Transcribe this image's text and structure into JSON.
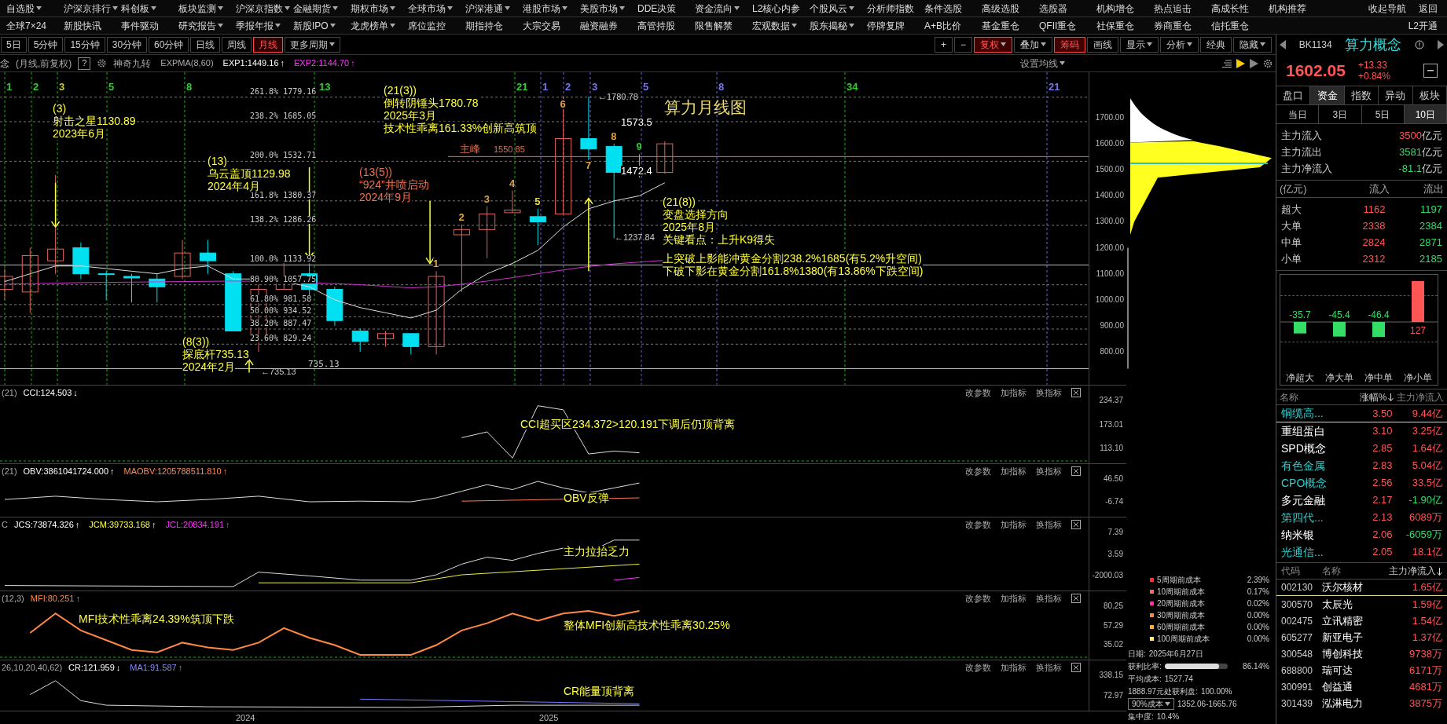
{
  "menu_rows": [
    {
      "items": [
        {
          "label": "自选股",
          "dropdown": true
        },
        {
          "label": "沪深京排行",
          "dropdown": true
        },
        {
          "label": "科创板",
          "dropdown": true
        },
        {
          "label": "板块监测",
          "dropdown": true
        },
        {
          "label": "沪深京指数",
          "dropdown": true
        },
        {
          "label": "金融期货",
          "dropdown": true
        },
        {
          "label": "期权市场",
          "dropdown": true
        },
        {
          "label": "全球市场",
          "dropdown": true
        },
        {
          "label": "沪深港通",
          "dropdown": true
        },
        {
          "label": "港股市场",
          "dropdown": true
        },
        {
          "label": "美股市场",
          "dropdown": true
        },
        {
          "label": "DDE决策",
          "dropdown": false
        },
        {
          "label": "资金流向",
          "dropdown": true
        },
        {
          "label": "L2核心内参",
          "dropdown": false
        },
        {
          "label": "个股风云",
          "dropdown": true
        },
        {
          "label": "分析师指数",
          "dropdown": false
        },
        {
          "label": "条件选股",
          "dropdown": false
        },
        {
          "label": "高级选股",
          "dropdown": false
        },
        {
          "label": "选股器",
          "dropdown": false
        },
        {
          "label": "机构增仓",
          "dropdown": false
        },
        {
          "label": "热点追击",
          "dropdown": false
        },
        {
          "label": "高成长性",
          "dropdown": false
        },
        {
          "label": "机构推荐",
          "dropdown": false
        }
      ],
      "right": [
        "收起导航",
        "返回"
      ]
    },
    {
      "items": [
        {
          "label": "全球7×24",
          "dropdown": false
        },
        {
          "label": "新股快讯",
          "dropdown": false
        },
        {
          "label": "事件驱动",
          "dropdown": false
        },
        {
          "label": "研究报告",
          "dropdown": true
        },
        {
          "label": "季报年报",
          "dropdown": true
        },
        {
          "label": "新股IPO",
          "dropdown": true
        },
        {
          "label": "龙虎榜单",
          "dropdown": true
        },
        {
          "label": "席位监控",
          "dropdown": false
        },
        {
          "label": "期指持仓",
          "dropdown": false
        },
        {
          "label": "大宗交易",
          "dropdown": false
        },
        {
          "label": "融资融券",
          "dropdown": false
        },
        {
          "label": "高管持股",
          "dropdown": false
        },
        {
          "label": "限售解禁",
          "dropdown": false
        },
        {
          "label": "宏观数据",
          "dropdown": true
        },
        {
          "label": "股东揭秘",
          "dropdown": true
        },
        {
          "label": "停牌复牌",
          "dropdown": false
        },
        {
          "label": "A+B比价",
          "dropdown": false
        },
        {
          "label": "基金重仓",
          "dropdown": false
        },
        {
          "label": "QFII重仓",
          "dropdown": false
        },
        {
          "label": "社保重仓",
          "dropdown": false
        },
        {
          "label": "券商重仓",
          "dropdown": false
        },
        {
          "label": "信托重仓",
          "dropdown": false
        }
      ],
      "right": [
        "L2开通"
      ]
    }
  ],
  "toolbar": {
    "periods": [
      {
        "label": "5日",
        "selected": false,
        "dropdown": false
      },
      {
        "label": "5分钟",
        "selected": false,
        "dropdown": false
      },
      {
        "label": "15分钟",
        "selected": false,
        "dropdown": false
      },
      {
        "label": "30分钟",
        "selected": false,
        "dropdown": false
      },
      {
        "label": "60分钟",
        "selected": false,
        "dropdown": false
      },
      {
        "label": "日线",
        "selected": false,
        "dropdown": false
      },
      {
        "label": "周线",
        "selected": false,
        "dropdown": false
      },
      {
        "label": "月线",
        "selected": true,
        "dropdown": false
      },
      {
        "label": "更多周期",
        "selected": false,
        "dropdown": true
      }
    ],
    "tools": [
      {
        "label": "+",
        "active": false,
        "dropdown": false
      },
      {
        "label": "−",
        "active": false,
        "dropdown": false
      },
      {
        "label": "复权",
        "active": true,
        "dropdown": true
      },
      {
        "label": "叠加",
        "active": false,
        "dropdown": true
      },
      {
        "label": "筹码",
        "active": true,
        "dropdown": false
      },
      {
        "label": "画线",
        "active": false,
        "dropdown": false
      },
      {
        "label": "显示",
        "active": false,
        "dropdown": true
      },
      {
        "label": "分析",
        "active": false,
        "dropdown": true
      },
      {
        "label": "经典",
        "active": false,
        "dropdown": false
      },
      {
        "label": "隐藏",
        "active": false,
        "dropdown": true
      }
    ]
  },
  "chart_header": {
    "name_fragment": "念",
    "mode": "(月线,前复权)",
    "help": "?",
    "indicator": "神奇九转",
    "expma": "EXPMA(8,60)",
    "values": [
      {
        "text": "EXP1:1449.16",
        "arrow": "↑",
        "color": "#ffffff"
      },
      {
        "text": "EXP2:1144.70",
        "arrow": "↑",
        "color": "#ff33ff"
      }
    ],
    "ma_setting": "设置均线"
  },
  "main_chart": {
    "count_marks": [
      {
        "text": "1",
        "color": "#33cc33"
      },
      {
        "text": "2",
        "color": "#33cc33"
      },
      {
        "text": "3",
        "color": "#cccc33"
      },
      {
        "text": "5",
        "color": "#33cc33"
      },
      {
        "text": "8",
        "color": "#33cc33"
      },
      {
        "text": "13",
        "color": "#33cc33"
      },
      {
        "text": "21",
        "color": "#33cc33"
      },
      {
        "text": "1",
        "color": "#7777ee"
      },
      {
        "text": "2",
        "color": "#7777ee"
      },
      {
        "text": "3",
        "color": "#7777ee"
      },
      {
        "text": "5",
        "color": "#7777ee"
      },
      {
        "text": "8",
        "color": "#7777ee"
      },
      {
        "text": "34",
        "color": "#33cc33"
      },
      {
        "text": "21",
        "color": "#7777ee"
      }
    ],
    "fib_levels": [
      "261.8% 1779.16",
      "238.2% 1685.05",
      "200.0% 1532.71",
      "161.8% 1380.37",
      "138.2% 1286.26",
      "100.0% 1133.92",
      "80.90% 1057.75",
      "61.80% 981.58",
      "50.00% 934.52",
      "38.20% 887.47",
      "23.60% 829.24"
    ],
    "base_label": "735.13",
    "candle_counts": [
      {
        "text": "1",
        "color": "#e0a040"
      },
      {
        "text": "2",
        "color": "#e0a040"
      },
      {
        "text": "3",
        "color": "#e0a040"
      },
      {
        "text": "4",
        "color": "#e0a040"
      },
      {
        "text": "5",
        "color": "#e0e040"
      },
      {
        "text": "6",
        "color": "#e0a040"
      },
      {
        "text": "7",
        "color": "#e0a040"
      },
      {
        "text": "8",
        "color": "#e0a040"
      },
      {
        "text": "9",
        "color": "#33cc33"
      }
    ],
    "annotations": [
      {
        "lines": [
          "(21(3))",
          "倒转阴锤头1780.78",
          "2025年3月",
          "技术性乖离161.33%创新高筑顶"
        ],
        "color": "#ffff40"
      },
      {
        "lines": [
          "(3)",
          "射击之星1130.89",
          "2023年6月"
        ],
        "color": "#ffff40"
      },
      {
        "lines": [
          "(13)",
          "乌云盖顶1129.98",
          "2024年4月"
        ],
        "color": "#ffff40"
      },
      {
        "lines": [
          "(13(5))",
          "“924”井喷启动",
          "2024年9月"
        ],
        "color": "#f07050"
      },
      {
        "lines": [
          "(21(8))",
          "变盘选择方向",
          "2025年8月",
          "关键看点：上升K9得失"
        ],
        "color": "#ffff40"
      },
      {
        "lines": [
          "上突破上影能冲黄金分割238.2%1685(有5.2%升空间)",
          "下破下影在黄金分割161.8%1380(有13.86%下跌空间)"
        ],
        "color": "#ffff40"
      },
      {
        "lines": [
          "(8(3))",
          "探底杆735.13",
          "2024年2月"
        ],
        "color": "#ffff40"
      }
    ],
    "title": "算力月线图",
    "peak": {
      "label": "主峰",
      "value": "1550.85"
    },
    "arrow_labels": [
      "←1780.78",
      "←1237.84",
      "←735.13"
    ],
    "price_notes": [
      "1573.5",
      "1472.4"
    ],
    "y_axis": [
      "1700.00",
      "1600.00",
      "1500.00",
      "1400.00",
      "1300.00",
      "1200.00",
      "1100.00",
      "1000.00",
      "900.00",
      "800.00"
    ]
  },
  "panels": [
    {
      "kind": "cci",
      "params": [
        "(21)"
      ],
      "values": [
        {
          "text": "CCI:124.503",
          "arrow": "↓",
          "color": "#ffffff"
        }
      ],
      "axis": [
        "234.37",
        "173.01",
        "113.10"
      ],
      "notes": [
        "CCI超买区234.372>120.191下调后仍顶背离"
      ]
    },
    {
      "kind": "obv",
      "params": [
        "(21)"
      ],
      "values": [
        {
          "text": "OBV:3861041724.000",
          "arrow": "↑",
          "color": "#ffffff"
        },
        {
          "text": "MAOBV:1205788511.810",
          "arrow": "↑",
          "color": "#ff8855"
        }
      ],
      "axis": [
        "46.50",
        "-6.74"
      ],
      "notes": [
        "OBV反弹"
      ]
    },
    {
      "kind": "jcs",
      "params": [
        "C"
      ],
      "values": [
        {
          "text": "JCS:73874.326",
          "arrow": "↑",
          "color": "#ffffff"
        },
        {
          "text": "JCM:39733.168",
          "arrow": "↑",
          "color": "#ffff40"
        },
        {
          "text": "JCL:20834.191",
          "arrow": "↑",
          "color": "#ff33ff"
        }
      ],
      "axis": [
        "7.39",
        "3.59",
        "-2000.03"
      ],
      "notes": [
        "主力拉抬乏力"
      ]
    },
    {
      "kind": "mfi",
      "params": [
        "(12,3)"
      ],
      "values": [
        {
          "text": "MFI:80.251",
          "arrow": "↑",
          "color": "#ff8844"
        }
      ],
      "axis": [
        "80.25",
        "57.29",
        "35.02"
      ],
      "notes": [
        "MFI技术性乖离24.39%筑顶下跌",
        "整体MFI创新高技术性乖离30.25%"
      ]
    },
    {
      "kind": "cr",
      "params": [
        "26,10,20,40,62)"
      ],
      "values": [
        {
          "text": "CR:121.959",
          "arrow": "↓",
          "color": "#ffffff"
        },
        {
          "text": "MA1:91.587",
          "arrow": "↑",
          "color": "#8888ff"
        }
      ],
      "axis": [
        "338.15",
        "72.97"
      ],
      "notes": [
        "CR能量顶背离"
      ]
    }
  ],
  "panel_actions": [
    [
      "改参数",
      "加指标",
      "换指标"
    ],
    [
      "改参数",
      "加指标",
      "换指标"
    ],
    [
      "改参数",
      "加指标",
      "换指标"
    ],
    [
      "改参数",
      "加指标",
      "换指标"
    ],
    [
      "改参数",
      "加指标",
      "换指标"
    ]
  ],
  "x_axis": [
    "2024",
    "2025"
  ],
  "cost_legend": {
    "items": [
      {
        "label": "5周期前成本",
        "value": "2.39%",
        "color": "#ff3333"
      },
      {
        "label": "10周期前成本",
        "value": "0.17%",
        "color": "#ff6666"
      },
      {
        "label": "20周期前成本",
        "value": "0.02%",
        "color": "#ff3399"
      },
      {
        "label": "30周期前成本",
        "value": "0.00%",
        "color": "#ff8833"
      },
      {
        "label": "60周期前成本",
        "value": "0.00%",
        "color": "#ffaa33"
      },
      {
        "label": "100周期前成本",
        "value": "0.00%",
        "color": "#ffee66"
      }
    ],
    "date": {
      "label": "日期:",
      "value": "2025年6月27日"
    },
    "profit": {
      "label": "获利比率:",
      "level": 0.8614,
      "value": "86.14%"
    },
    "avg_cost": {
      "label": "平均成本:",
      "value": "1527.74"
    },
    "profit_at": {
      "label": "1888.97元处获利盘:",
      "value": "100.00%"
    },
    "range": {
      "select": "90%成本",
      "value": "1352.06-1665.76"
    },
    "concentration": {
      "label": "集中度:",
      "value": "10.4%"
    }
  },
  "quote": {
    "code": "BK1134",
    "name": "算力概念",
    "price": "1602.05",
    "change": "+13.33",
    "change_pct": "+0.84%"
  },
  "tabs": [
    {
      "label": "盘口",
      "selected": false
    },
    {
      "label": "资金",
      "selected": true
    },
    {
      "label": "指数",
      "selected": false
    },
    {
      "label": "异动",
      "selected": false
    },
    {
      "label": "板块",
      "selected": false
    }
  ],
  "day_tabs": [
    {
      "label": "当日",
      "selected": false
    },
    {
      "label": "3日",
      "selected": false
    },
    {
      "label": "5日",
      "selected": false
    },
    {
      "label": "10日",
      "selected": true
    }
  ],
  "flow_summary": [
    {
      "label": "主力流入",
      "value": "3500",
      "unit": "亿元",
      "positive": true
    },
    {
      "label": "主力流出",
      "value": "3581",
      "unit": "亿元",
      "positive": false
    },
    {
      "label": "主力净流入",
      "value": "-81.1",
      "unit": "亿元",
      "positive": false
    }
  ],
  "flow_table": {
    "columns": [
      "(亿元)",
      "流入",
      "流出"
    ],
    "rows": [
      {
        "label": "超大",
        "in": "1162",
        "out": "1197"
      },
      {
        "label": "大单",
        "in": "2338",
        "out": "2384"
      },
      {
        "label": "中单",
        "in": "2824",
        "out": "2871"
      },
      {
        "label": "小单",
        "in": "2312",
        "out": "2185"
      }
    ]
  },
  "net_chart": {
    "chart_data": {
      "type": "bar",
      "categories": [
        "净超大",
        "净大单",
        "净中单",
        "净小单"
      ],
      "values": [
        -35.7,
        -45.4,
        -46.4,
        127
      ],
      "data_labels": true
    }
  },
  "sectors": {
    "columns": [
      {
        "label": "名称",
        "sorted": false
      },
      {
        "label": "涨幅%",
        "sorted": true
      },
      {
        "label": "主力净流入",
        "sorted": false
      }
    ],
    "rows": [
      {
        "name": "铜缆高...",
        "change": "3.50",
        "flow": "9.44亿",
        "positive": true,
        "color": "#33cccc",
        "selected": true
      },
      {
        "name": "重组蛋白",
        "change": "3.10",
        "flow": "3.25亿",
        "positive": true,
        "color": "#ffffff",
        "selected": false
      },
      {
        "name": "SPD概念",
        "change": "2.85",
        "flow": "1.64亿",
        "positive": true,
        "color": "#ffffff",
        "selected": false
      },
      {
        "name": "有色金属",
        "change": "2.83",
        "flow": "5.04亿",
        "positive": true,
        "color": "#33cccc",
        "selected": false
      },
      {
        "name": "CPO概念",
        "change": "2.56",
        "flow": "33.5亿",
        "positive": true,
        "color": "#33cccc",
        "selected": false
      },
      {
        "name": "多元金融",
        "change": "2.17",
        "flow": "-1.90亿",
        "positive": false,
        "color": "#ffffff",
        "selected": false
      },
      {
        "name": "第四代...",
        "change": "2.13",
        "flow": "6089万",
        "positive": true,
        "color": "#33cccc",
        "selected": false
      },
      {
        "name": "纳米银",
        "change": "2.06",
        "flow": "-6059万",
        "positive": false,
        "color": "#ffffff",
        "selected": false
      },
      {
        "name": "光通信...",
        "change": "2.05",
        "flow": "18.1亿",
        "positive": true,
        "color": "#33cccc",
        "selected": false
      }
    ]
  },
  "stocks": {
    "columns": [
      {
        "label": "代码",
        "sorted": false
      },
      {
        "label": "名称",
        "sorted": false
      },
      {
        "label": "主力净流入",
        "sorted": true
      }
    ],
    "rows": [
      {
        "code": "002130",
        "name": "沃尔核材",
        "flow": "1.65亿",
        "selected": true
      },
      {
        "code": "300570",
        "name": "太辰光",
        "flow": "1.59亿",
        "selected": false
      },
      {
        "code": "002475",
        "name": "立讯精密",
        "flow": "1.54亿",
        "selected": false
      },
      {
        "code": "605277",
        "name": "新亚电子",
        "flow": "1.37亿",
        "selected": false
      },
      {
        "code": "300548",
        "name": "博创科技",
        "flow": "9738万",
        "selected": false
      },
      {
        "code": "688800",
        "name": "瑞可达",
        "flow": "6171万",
        "selected": false
      },
      {
        "code": "300991",
        "name": "创益通",
        "flow": "4681万",
        "selected": false
      },
      {
        "code": "301439",
        "name": "泓淋电力",
        "flow": "3875万",
        "selected": false
      }
    ]
  }
}
